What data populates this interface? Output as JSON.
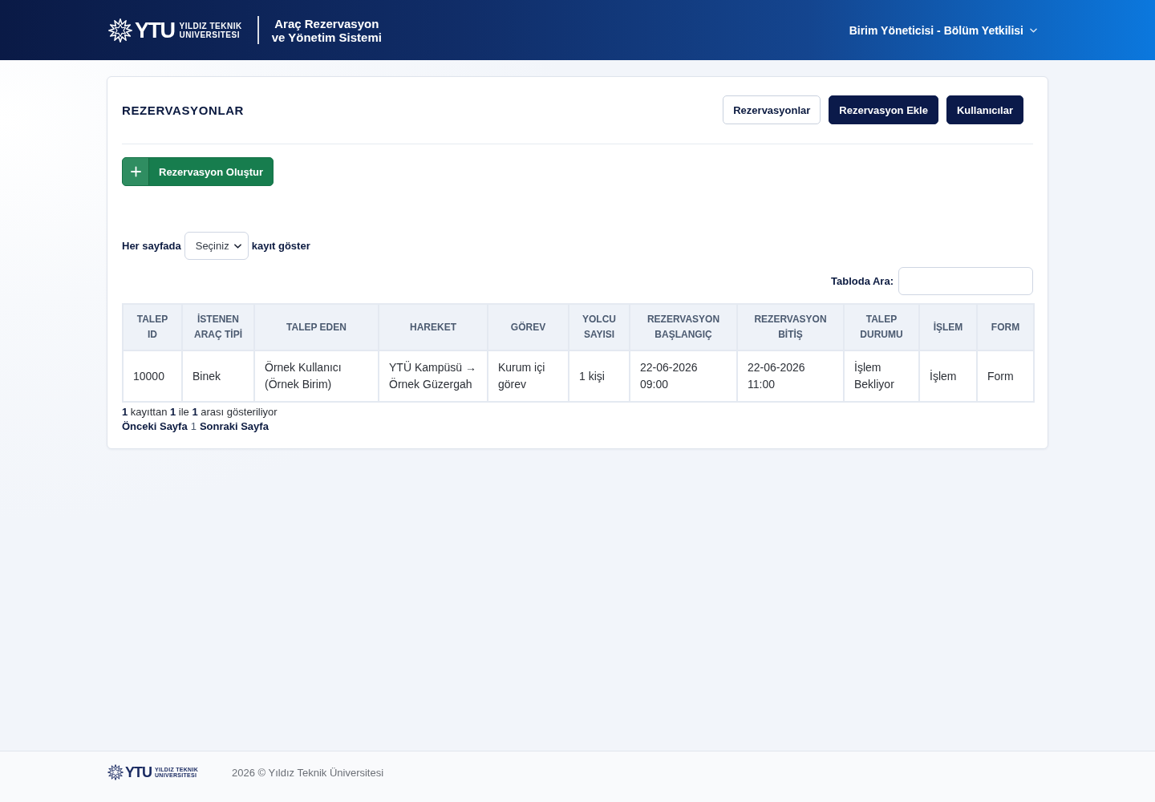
{
  "header": {
    "logo": {
      "mark": "YTU",
      "line_1": "YILDIZ TEKNIK",
      "line_2": "UNIVERSITESI"
    },
    "app_title": [
      "Araç Rezervasyon",
      "ve Yönetim Sistemi"
    ],
    "user_menu": "Birim Yöneticisi - Bölüm Yetkilisi"
  },
  "panel": {
    "title": "REZERVASYONLAR",
    "nav_buttons": [
      {
        "label": "Rezervasyonlar",
        "selected": true
      },
      {
        "label": "Rezervasyon Ekle",
        "selected": false
      },
      {
        "label": "Kullanıcılar",
        "selected": false
      }
    ],
    "create_button": "Rezervasyon Oluştur",
    "page_length": {
      "before": "Her sayfada",
      "select": "Seçiniz",
      "after": "kayıt göster"
    },
    "search": {
      "label": "Tabloda Ara:"
    },
    "table": {
      "columns": [
        "TALEP ID",
        "İSTENEN ARAÇ TİPİ",
        "TALEP EDEN",
        "HAREKET",
        "GÖREV",
        "YOLCU SAYISI",
        "REZERVASYON BAŞLANGIÇ",
        "REZERVASYON BİTİŞ",
        "TALEP DURUMU",
        "İŞLEM",
        "FORM"
      ],
      "rows": [
        [
          "10000",
          "Binek",
          "Örnek Kullanıcı (Örnek Birim)",
          "YTÜ Kampüsü → Örnek Güzergah",
          "Kurum içi görev",
          "1 kişi",
          "22-06-2026 09:00",
          "22-06-2026 11:00",
          "İşlem Bekliyor",
          "İşlem",
          "Form"
        ]
      ]
    },
    "info": "**1** kayıttan **1** ile **1** arası gösteriliyor",
    "pagination": {
      "previous": "Önceki Sayfa",
      "pages": [
        {
          "label": "1",
          "selected": true
        }
      ],
      "next": "Sonraki Sayfa"
    }
  },
  "footer": {
    "logo": {
      "mark": "YTU",
      "line_1": "YILDIZ TEKNIK",
      "line_2": "UNIVERSITESI"
    },
    "copyright": "2026 © Yıldız Teknik Üniversitesi"
  }
}
